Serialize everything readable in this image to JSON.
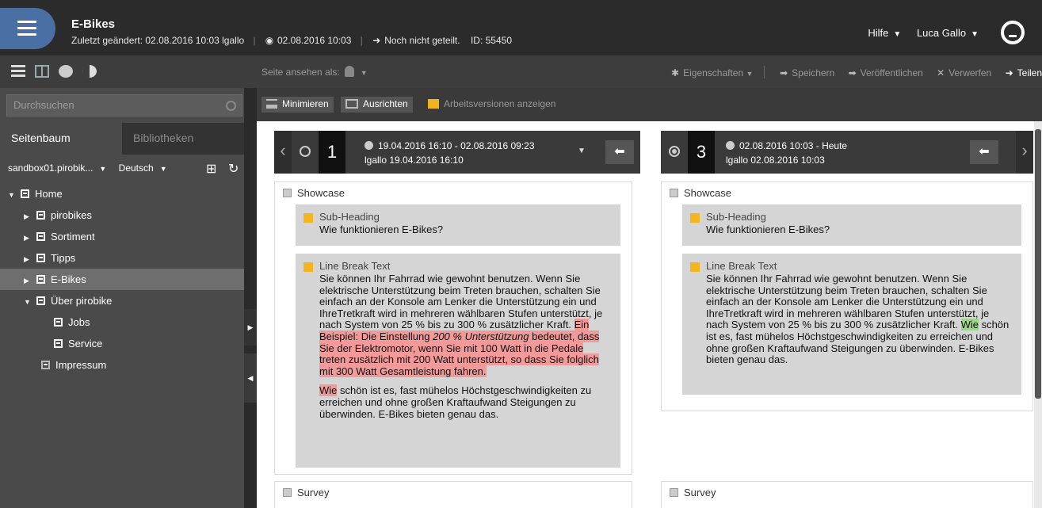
{
  "header": {
    "title": "E-Bikes",
    "last_changed": "Zuletzt geändert: 02.08.2016 10:03 lgallo",
    "published": "02.08.2016 10:03",
    "shared": "Noch nicht geteilt.",
    "id": "ID: 55450",
    "help": "Hilfe",
    "user": "Luca Gallo"
  },
  "toolbar": {
    "view_as": "Seite ansehen als:",
    "properties": "Eigenschaften",
    "save": "Speichern",
    "publish": "Veröffentlichen",
    "discard": "Verwerfen",
    "share": "Teilen"
  },
  "sidebar": {
    "search_placeholder": "Durchsuchen",
    "tabs": [
      "Seitenbaum",
      "Bibliotheken"
    ],
    "site": "sandbox01.pirobik...",
    "language": "Deutsch",
    "tree": [
      {
        "label": "Home"
      },
      {
        "label": "pirobikes"
      },
      {
        "label": "Sortiment"
      },
      {
        "label": "Tipps"
      },
      {
        "label": "E-Bikes"
      },
      {
        "label": "Über pirobike"
      },
      {
        "label": "Jobs"
      },
      {
        "label": "Service"
      },
      {
        "label": "Impressum"
      }
    ]
  },
  "compare": {
    "minimize": "Minimieren",
    "align": "Ausrichten",
    "show_working": "Arbeitsversionen anzeigen",
    "left": {
      "number": "1",
      "range": "19.04.2016 16:10 - 02.08.2016 09:23",
      "author": "lgallo 19.04.2016 16:10"
    },
    "right": {
      "number": "3",
      "range": "02.08.2016 10:03 - Heute",
      "author": "lgallo 02.08.2016 10:03"
    }
  },
  "content": {
    "section1": "Showcase",
    "subheading_label": "Sub-Heading",
    "subheading_text": "Wie funktionieren E-Bikes?",
    "linebreak_label": "Line Break Text",
    "common_text": "Sie können Ihr Fahrrad wie gewohnt benutzen. Wenn Sie elektrische Unterstützung beim Treten brauchen, schalten Sie einfach an der Konsole am Lenker die Unterstützung ein und IhreTretkraft wird in mehreren wählbaren Stufen unterstützt, je nach System von 25 % bis zu 300 % zusätzlicher Kraft.",
    "left_deleted_1": "Ein Beispiel: Die Einstellung",
    "left_deleted_italic": "200 % Unterstützung",
    "left_deleted_2": "bedeutet, dass Sie der Elektromotor, wenn Sie mit 100 Watt in die Pedale treten zusätzlich mit 200 Watt unterstützt, so dass Sie folglich mit 300 Watt Gesamtleistung fahren.",
    "left_deleted_wie": "Wie",
    "left_tail": "schön ist es, fast mühelos Höchstgeschwindigkeiten zu erreichen und ohne großen Kraftaufwand Steigungen zu überwinden.  E-Bikes bieten genau das.",
    "right_added_wie": "Wie",
    "right_tail": "schön ist es, fast mühelos Höchstgeschwindigkeiten zu erreichen und ohne großen Kraftaufwand Steigungen zu überwinden.  E-Bikes bieten genau das.",
    "section2": "Survey"
  },
  "colors": {
    "accent": "#4a6fa5",
    "deleted": "#f29a9a",
    "added": "#9fd48c",
    "element": "#f5b51e"
  }
}
